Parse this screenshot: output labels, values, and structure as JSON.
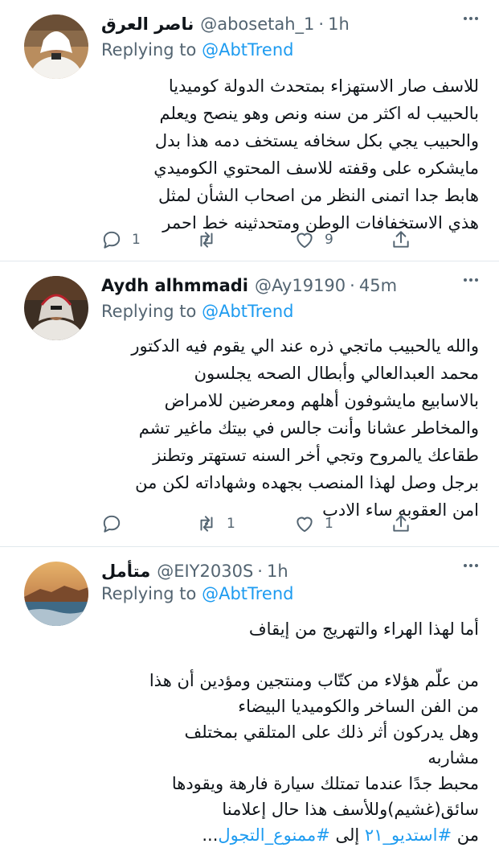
{
  "mention_color": "#1d9bf0",
  "tweets": [
    {
      "name": "ناصر العرق",
      "handle": "@abosetah_1",
      "dot": "·",
      "time": "1h",
      "replying_prefix": "Replying to ",
      "replying_to": "@AbtTrend",
      "lines": [
        "للاسف صار الاستهزاء بمتحدث الدولة كوميديا",
        "بالحبيب له اكثر من سنه ونص وهو ينصح ويعلم",
        "والحبيب يجي بكل سخافه يستخف دمه هذا بدل",
        "مايشكره على وقفته للاسف المحتوي الكوميدي",
        "هابط جدا  اتمنى النظر من اصحاب الشأن لمثل",
        "هذي الاستخفافات الوطن ومتحدثينه خط احمر"
      ],
      "reply_count": "1",
      "retweet_count": "",
      "like_count": "9"
    },
    {
      "name": "Aydh alhmmadi",
      "handle": "@Ay19190",
      "dot": "·",
      "time": "45m",
      "replying_prefix": "Replying to ",
      "replying_to": "@AbtTrend",
      "lines": [
        "والله يالحبيب ماتجي ذره عند الي يقوم فيه الدكتور",
        "محمد العبدالعالي وأبطال الصحه يجلسون",
        "بالاسابيع مايشوفون أهلهم ومعرضين للامراض",
        "والمخاطر عشانا وأنت جالس في بيتك ماغير تشم",
        "طقاعك يالمروح وتجي أخر السنه تستهتر وتطنز",
        "برجل وصل لهذا المنصب بجهده وشهاداته لكن من",
        "امن العقوبه ساء الادب"
      ],
      "reply_count": "",
      "retweet_count": "1",
      "like_count": "1"
    },
    {
      "name": "متأمل",
      "handle": "@EIY2030S",
      "dot": "·",
      "time": "1h",
      "replying_prefix": "Replying to ",
      "replying_to": "@AbtTrend",
      "lines": [
        "أما لهذا الهراء والتهريج من إيقاف",
        "",
        "من علّم هؤلاء من كتّاب ومنتجين ومؤدين أن هذا",
        "من الفن الساخر والكوميديا البيضاء",
        "وهل يدركون أثر ذلك على المتلقي بمختلف",
        "مشاربه",
        "محبط جدًا عندما تمتلك سيارة فارهة ويقودها",
        "سائق(غشيم)وللأسف هذا حال إعلامنا"
      ],
      "last_line": {
        "prefix": "من ",
        "hashtag1": "#استديو_٢١",
        "middle": " إلى ",
        "hashtag2": "#ممنوع_التجول",
        "ellipsis": "..."
      }
    }
  ]
}
